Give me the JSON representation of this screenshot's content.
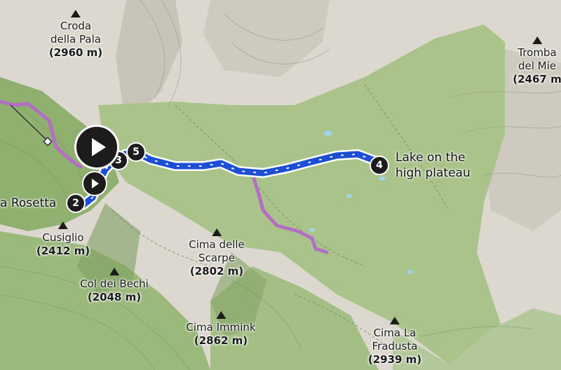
{
  "map": {
    "colors": {
      "rock": "#dcd8cf",
      "meadow": "#a9c38a",
      "forest": "#8fb06f",
      "route": "#1d4fd6",
      "trail": "#b46fc2"
    },
    "peaks": [
      {
        "id": "croda-della-pala",
        "name_lines": [
          "Croda",
          "della Pala"
        ],
        "elevation": "(2960 m)"
      },
      {
        "id": "cusiglio",
        "name_lines": [
          "Cusiglio"
        ],
        "elevation": "(2412 m)"
      },
      {
        "id": "col-dei-bechi",
        "name_lines": [
          "Col dei Bechi"
        ],
        "elevation": "(2048 m)"
      },
      {
        "id": "cima-delle-scarpe",
        "name_lines": [
          "Cima delle",
          "Scarpe"
        ],
        "elevation": "(2802 m)"
      },
      {
        "id": "cima-immink",
        "name_lines": [
          "Cima Immink"
        ],
        "elevation": "(2862 m)"
      },
      {
        "id": "cima-la-fradusta",
        "name_lines": [
          "Cima La",
          "Fradusta"
        ],
        "elevation": "(2939 m)"
      },
      {
        "id": "tromba-del-mie",
        "name_lines": [
          "Tromba",
          "del Mie"
        ],
        "elevation": "(2467 m"
      }
    ],
    "waypoints": [
      {
        "number": "2",
        "label": "a Rosetta"
      },
      {
        "number": "3",
        "label": ""
      },
      {
        "number": "5",
        "label": ""
      },
      {
        "number": "4",
        "label": "Lake on the\nhigh plateau"
      }
    ],
    "lake_label_line1": "Lake on the",
    "lake_label_line2": "high plateau",
    "rosetta_label": "a Rosetta"
  }
}
